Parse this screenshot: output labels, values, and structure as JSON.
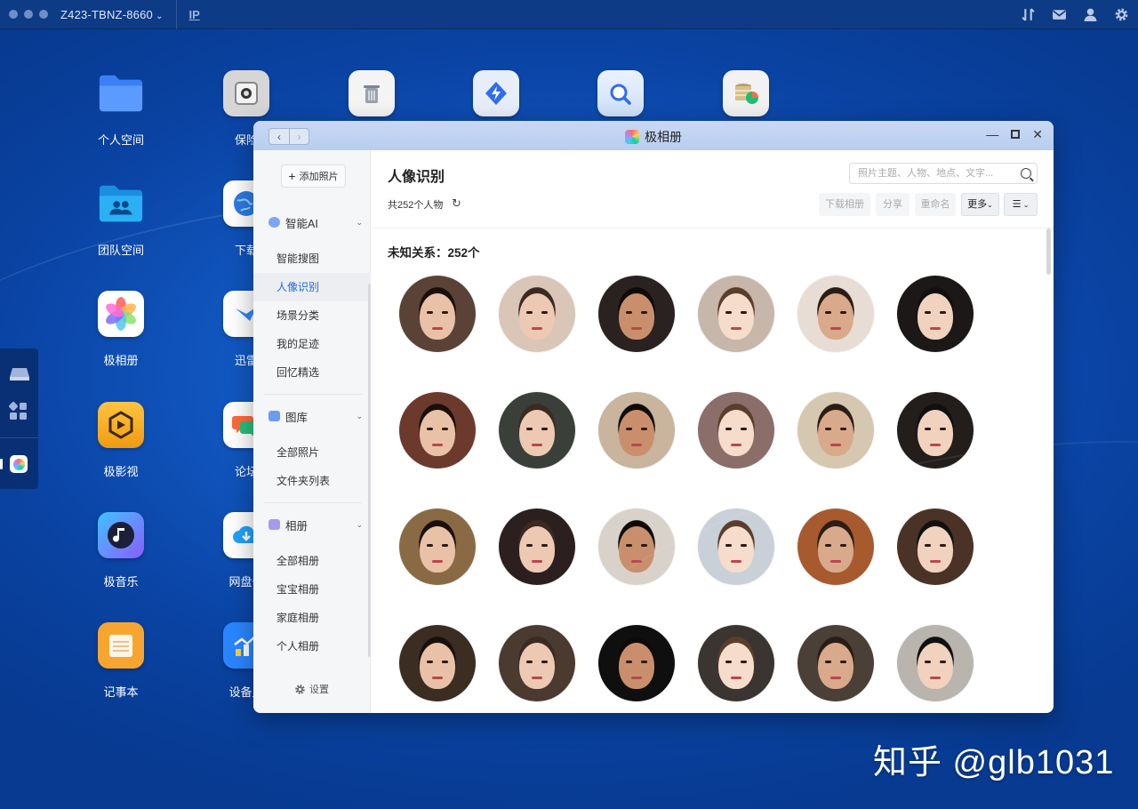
{
  "topbar": {
    "device_name": "Z423-TBNZ-8660",
    "ip_label": "IP",
    "right_icons": [
      "transfer-icon",
      "mail-icon",
      "user-icon",
      "gear-icon"
    ]
  },
  "desktop": {
    "col1": [
      {
        "label": "个人空间",
        "icon": "folder-icon",
        "color": "#3d8bff"
      },
      {
        "label": "团队空间",
        "icon": "team-folder-icon",
        "color": "#27a8f0"
      },
      {
        "label": "极相册",
        "icon": "photos-icon",
        "color": "#ffffff"
      },
      {
        "label": "极影视",
        "icon": "video-icon",
        "color": "#f5a623"
      },
      {
        "label": "极音乐",
        "icon": "music-icon",
        "color": "#6b5cff"
      },
      {
        "label": "记事本",
        "icon": "notepad-icon",
        "color": "#f7a531"
      }
    ],
    "col2": [
      {
        "label": "保险",
        "icon": "safe-icon",
        "color": "#d8d8d8"
      },
      {
        "label": "下载",
        "icon": "globe-icon",
        "color": "#2c7be5"
      },
      {
        "label": "迅雷",
        "icon": "bird-icon",
        "color": "#ffffff"
      },
      {
        "label": "论坛",
        "icon": "chat-icon",
        "color": "#ffffff"
      },
      {
        "label": "网盘备",
        "icon": "cloud-icon",
        "color": "#1fa3ff"
      },
      {
        "label": "设备监",
        "icon": "monitor-icon",
        "color": "#2a86ff"
      }
    ],
    "top_row_icons": [
      "trash-icon",
      "speed-icon",
      "search-advanced-icon",
      "database-icon"
    ]
  },
  "window": {
    "title": "极相册",
    "sidebar": {
      "add_button": "添加照片",
      "groups": [
        {
          "label": "智能AI",
          "items": [
            "智能搜图",
            "人像识别",
            "场景分类",
            "我的足迹",
            "回忆精选"
          ]
        },
        {
          "label": "图库",
          "items": [
            "全部照片",
            "文件夹列表"
          ]
        },
        {
          "label": "相册",
          "items": [
            "全部相册",
            "宝宝相册",
            "家庭相册",
            "个人相册"
          ]
        }
      ],
      "active_item": "人像识别",
      "settings": "设置"
    },
    "main": {
      "title": "人像识别",
      "search_placeholder": "照片主题、人物、地点、文字...",
      "count_text": "共252个人物",
      "toolbar": {
        "download": "下载相册",
        "share": "分享",
        "rename": "重命名",
        "more": "更多"
      },
      "section_title": "未知关系：252个"
    }
  },
  "watermark": "知乎 @glb1031"
}
